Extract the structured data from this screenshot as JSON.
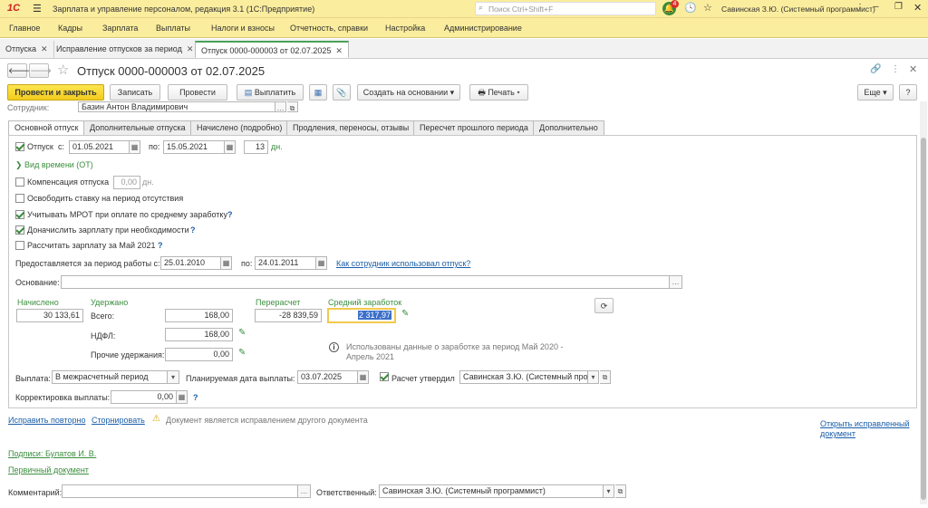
{
  "app": {
    "logo": "1С",
    "title": "Зарплата и управление персоналом, редакция 3.1  (1С:Предприятие)",
    "search_placeholder": "Поиск Ctrl+Shift+F",
    "notif_count": "4",
    "user": "Савинская З.Ю. (Системный программист)"
  },
  "menu": [
    "Главное",
    "Кадры",
    "Зарплата",
    "Выплаты",
    "Налоги и взносы",
    "Отчетность, справки",
    "Настройка",
    "Администрирование"
  ],
  "open_tabs": [
    {
      "label": "Отпуска"
    },
    {
      "label": "Исправление отпусков за период"
    },
    {
      "label": "Отпуск 0000-000003 от 02.07.2025"
    }
  ],
  "doc": {
    "title": "Отпуск 0000-000003 от 02.07.2025"
  },
  "toolbar": {
    "post_close": "Провести и закрыть",
    "save": "Записать",
    "post": "Провести",
    "pay": "Выплатить",
    "create_based": "Создать на основании",
    "print": "Печать",
    "more": "Еще",
    "help": "?"
  },
  "employee": {
    "label": "Сотрудник:",
    "value": "Базин Антон Владимирович"
  },
  "form_tabs": [
    "Основной отпуск",
    "Дополнительные отпуска",
    "Начислено (подробно)",
    "Продления, переносы, отзывы",
    "Пересчет прошлого периода",
    "Дополнительно"
  ],
  "vacation": {
    "label": "Отпуск",
    "from_label": "с:",
    "from": "01.05.2021",
    "to_label": "по:",
    "to": "15.05.2021",
    "days": "13",
    "days_unit": "дн."
  },
  "time_kind": "Вид времени (ОТ)",
  "compensation": {
    "label": "Компенсация отпуска",
    "value": "0,00",
    "unit": "дн."
  },
  "checks": {
    "free_rate": "Освободить ставку на период отсутствия",
    "mrot": "Учитывать МРОТ при оплате по среднему заработку",
    "accrue": "Доначислить зарплату при необходимости",
    "calc_salary": "Рассчитать зарплату за Май 2021"
  },
  "period": {
    "label": "Предоставляется за период работы с:",
    "from": "25.01.2010",
    "to_label": "по:",
    "to": "24.01.2011",
    "link": "Как сотрудник использовал отпуск?"
  },
  "basis": {
    "label": "Основание:",
    "value": ""
  },
  "totals": {
    "accrued_label": "Начислено",
    "accrued": "30 133,61",
    "withheld_label": "Удержано",
    "total_label": "Всего:",
    "total": "168,00",
    "ndfl_label": "НДФЛ:",
    "ndfl": "168,00",
    "other_label": "Прочие удержания:",
    "other": "0,00",
    "recalc_label": "Перерасчет",
    "recalc": "-28 839,59",
    "avg_label": "Средний заработок",
    "avg": "2 317,97",
    "info": "Использованы данные о заработке за период Май 2020 - Апрель 2021"
  },
  "payment": {
    "label": "Выплата:",
    "value": "В межрасчетный период",
    "date_label": "Планируемая дата выплаты:",
    "date": "03.07.2025",
    "approved_label": "Расчет утвердил",
    "approved": "Савинская З.Ю. (Системный прог"
  },
  "correction": {
    "label": "Корректировка выплаты:",
    "value": "0,00"
  },
  "footer": {
    "fix_again": "Исправить повторно",
    "reverse": "Сторнировать",
    "warning": "Документ является исправлением другого документа",
    "open_fixed_1": "Открыть исправленный",
    "open_fixed_2": "документ",
    "signatures": "Подписи: Булатов И. В.",
    "primary_doc": "Первичный документ",
    "comment_label": "Комментарий:",
    "comment": "",
    "responsible_label": "Ответственный:",
    "responsible": "Савинская З.Ю. (Системный программист)"
  }
}
